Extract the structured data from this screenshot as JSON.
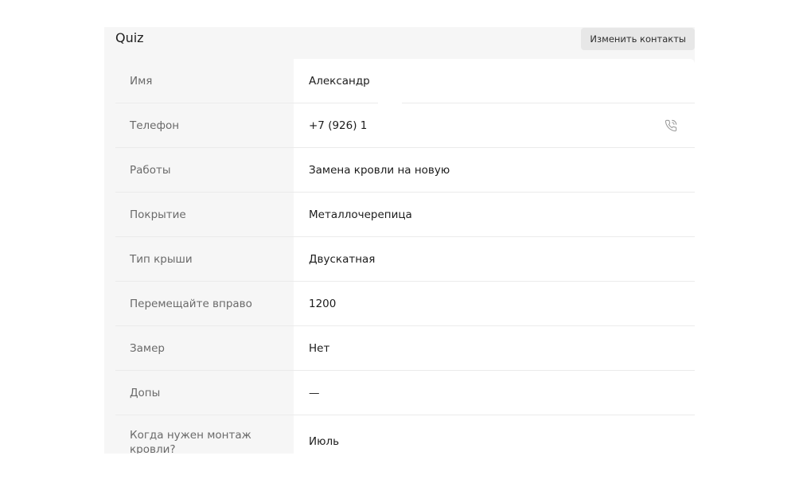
{
  "header": {
    "title": "Quiz",
    "edit_button": "Изменить контакты"
  },
  "rows": [
    {
      "label": "Имя",
      "value": "Александр"
    },
    {
      "label": "Телефон",
      "value": "+7 (926) 1",
      "icon": "phone-call-icon"
    },
    {
      "label": "Работы",
      "value": "Замена кровли на новую"
    },
    {
      "label": "Покрытие",
      "value": "Металлочерепица"
    },
    {
      "label": "Тип крыши",
      "value": "Двускатная"
    },
    {
      "label": "Перемещайте вправо",
      "value": "1200"
    },
    {
      "label": "Замер",
      "value": "Нет"
    },
    {
      "label": "Допы",
      "value": "—"
    },
    {
      "label": "Когда нужен монтаж кровли?",
      "value": "Июль"
    }
  ],
  "colors": {
    "panel_bg": "#f6f6f6",
    "label_text": "#6a6a6a",
    "value_text": "#1c1c1c",
    "button_bg": "#e7e7e7"
  }
}
